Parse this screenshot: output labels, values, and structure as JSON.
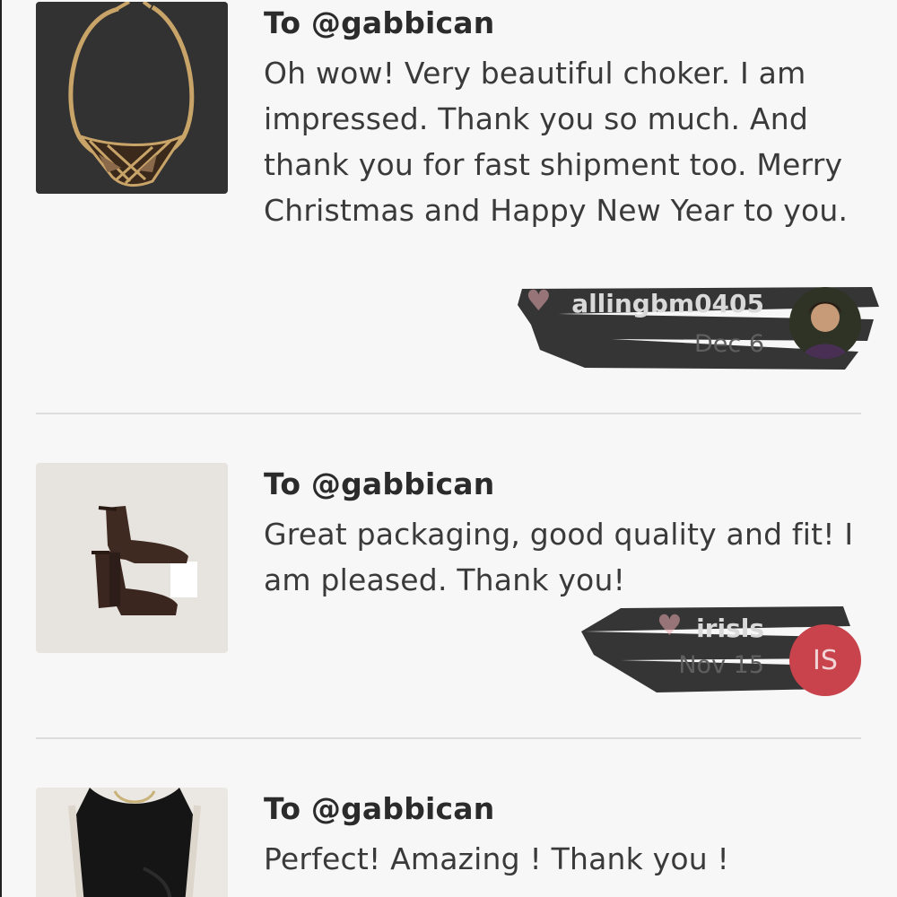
{
  "reviews": [
    {
      "to": "To @gabbican",
      "comment": "Oh wow! Very beautiful choker. I am impressed. Thank you so much. And thank you for fast shipment too. Merry Christmas and Happy New Year to you.",
      "username": "allingbm0405",
      "date": "Dec 6",
      "item": "choker-necklace-photo"
    },
    {
      "to": "To @gabbican",
      "comment": "Great packaging, good quality and fit! I am pleased. Thank you!",
      "username": "irisls",
      "date": "Nov 15",
      "avatar_initials": "IS",
      "item": "ankle-boots-photo"
    },
    {
      "to": "To @gabbican",
      "comment": "Perfect! Amazing ! Thank you !",
      "item": "black-dress-photo"
    }
  ],
  "colors": {
    "background": "#f7f7f7",
    "avatar_red": "#c9434c",
    "heart": "#e8a8ae"
  }
}
